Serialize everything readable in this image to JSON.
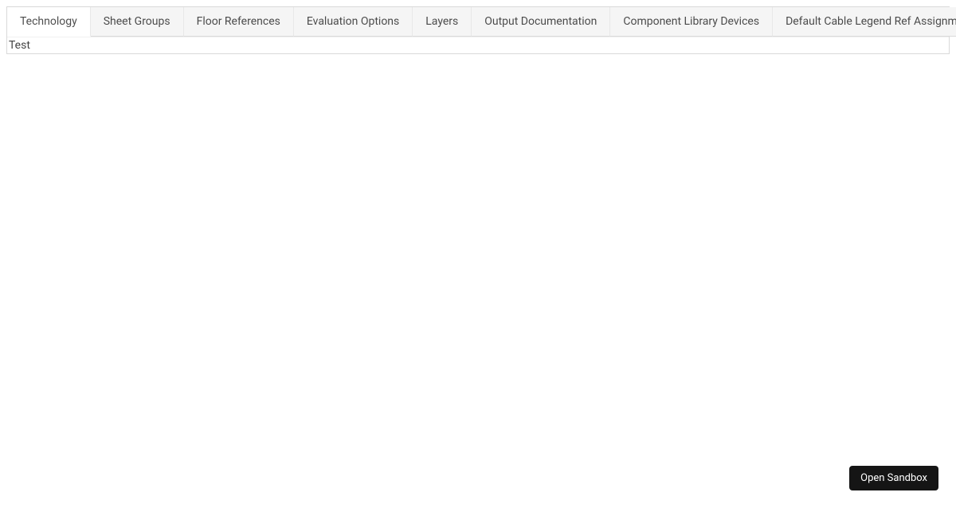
{
  "tabs": [
    {
      "label": "Technology",
      "active": true
    },
    {
      "label": "Sheet Groups",
      "active": false
    },
    {
      "label": "Floor References",
      "active": false
    },
    {
      "label": "Evaluation Options",
      "active": false
    },
    {
      "label": "Layers",
      "active": false
    },
    {
      "label": "Output Documentation",
      "active": false
    },
    {
      "label": "Component Library Devices",
      "active": false
    },
    {
      "label": "Default Cable Legend Ref Assignments",
      "active": false
    }
  ],
  "content": {
    "text": "Test"
  },
  "sandbox": {
    "label": "Open Sandbox"
  }
}
